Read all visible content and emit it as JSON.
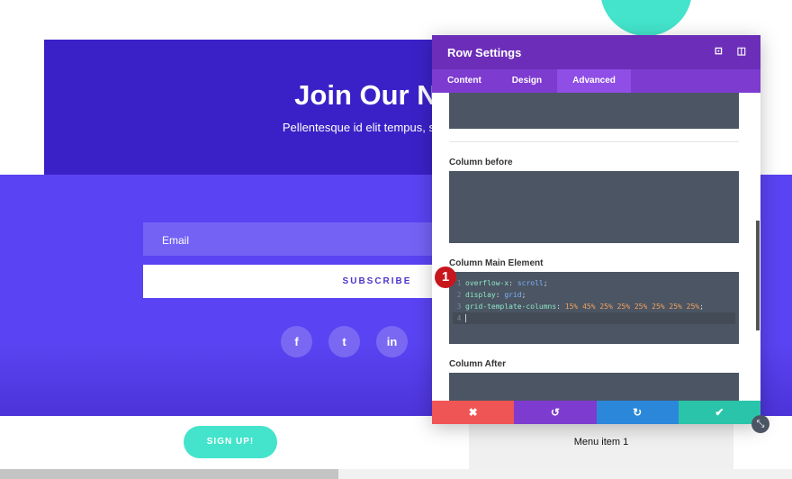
{
  "page": {
    "title": "Join Our Newsl",
    "subtitle": "Pellentesque id elit tempus, semper nibh qu",
    "email_placeholder": "Email",
    "subscribe_label": "SUBSCRIBE",
    "social": [
      {
        "icon": "facebook-icon",
        "glyph": "f"
      },
      {
        "icon": "twitter-icon",
        "glyph": "t"
      },
      {
        "icon": "linkedin-icon",
        "glyph": "in"
      }
    ],
    "signup_label": "SIGN UP!",
    "menu_item": "Menu item 1"
  },
  "panel": {
    "title": "Row Settings",
    "tabs": [
      "Content",
      "Design",
      "Advanced"
    ],
    "active_tab": "Advanced",
    "fields": {
      "column_before": "Column before",
      "column_main": "Column Main Element",
      "column_after": "Column After"
    },
    "code": {
      "l1_prop": "overflow-x",
      "l1_val": "scroll",
      "l2_prop": "display",
      "l2_val": "grid",
      "l3_prop": "grid-template-columns",
      "l3_val": "15% 45% 25% 25% 25% 25% 25% 25%"
    },
    "badge": "1"
  },
  "colors": {
    "accent": "#6c2eb9",
    "cancel": "#ef5555",
    "undo": "#7e3bd0",
    "redo": "#2b87da",
    "save": "#29c4a9",
    "teal": "#43e4cb"
  }
}
